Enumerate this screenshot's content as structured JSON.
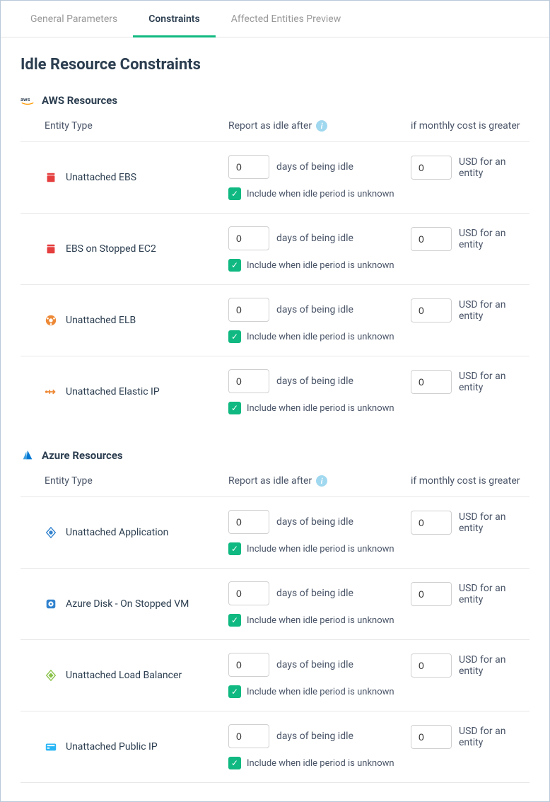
{
  "tabs": {
    "general": "General Parameters",
    "constraints": "Constraints",
    "affected": "Affected Entities Preview"
  },
  "page_title": "Idle Resource Constraints",
  "columns": {
    "entity": "Entity Type",
    "idle": "Report as idle after",
    "cost": "if monthly cost is greater"
  },
  "labels": {
    "days_idle": "days of being idle",
    "include_unknown": "Include when idle period is unknown",
    "usd_entity": "USD for an entity",
    "info": "i"
  },
  "sections": [
    {
      "title": "AWS Resources",
      "provider": "aws",
      "rows": [
        {
          "icon": "ebs",
          "name": "Unattached EBS",
          "days": "0",
          "include": true,
          "cost": "0"
        },
        {
          "icon": "ebs",
          "name": "EBS on Stopped EC2",
          "days": "0",
          "include": true,
          "cost": "0"
        },
        {
          "icon": "elb",
          "name": "Unattached ELB",
          "days": "0",
          "include": true,
          "cost": "0"
        },
        {
          "icon": "eip",
          "name": "Unattached Elastic IP",
          "days": "0",
          "include": true,
          "cost": "0"
        }
      ]
    },
    {
      "title": "Azure Resources",
      "provider": "azure",
      "rows": [
        {
          "icon": "app",
          "name": "Unattached Application",
          "days": "0",
          "include": true,
          "cost": "0"
        },
        {
          "icon": "disk",
          "name": "Azure Disk - On Stopped VM",
          "days": "0",
          "include": true,
          "cost": "0"
        },
        {
          "icon": "lb",
          "name": "Unattached Load Balancer",
          "days": "0",
          "include": true,
          "cost": "0"
        },
        {
          "icon": "pip",
          "name": "Unattached Public IP",
          "days": "0",
          "include": true,
          "cost": "0"
        }
      ]
    }
  ]
}
